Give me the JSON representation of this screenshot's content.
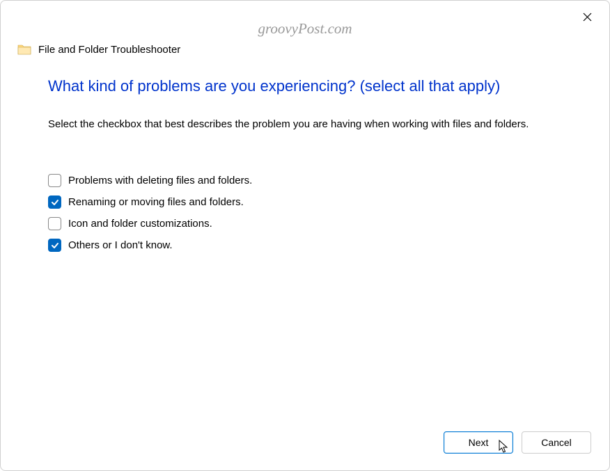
{
  "watermark": "groovyPost.com",
  "app_title": "File and Folder Troubleshooter",
  "heading": "What kind of problems are you experiencing? (select all that apply)",
  "description": "Select the checkbox that best describes the problem you are having when working with files and folders.",
  "options": [
    {
      "label": "Problems with deleting files and folders.",
      "checked": false
    },
    {
      "label": "Renaming or moving files and folders.",
      "checked": true
    },
    {
      "label": "Icon and folder customizations.",
      "checked": false
    },
    {
      "label": "Others or I don't know.",
      "checked": true
    }
  ],
  "buttons": {
    "next": "Next",
    "cancel": "Cancel"
  }
}
